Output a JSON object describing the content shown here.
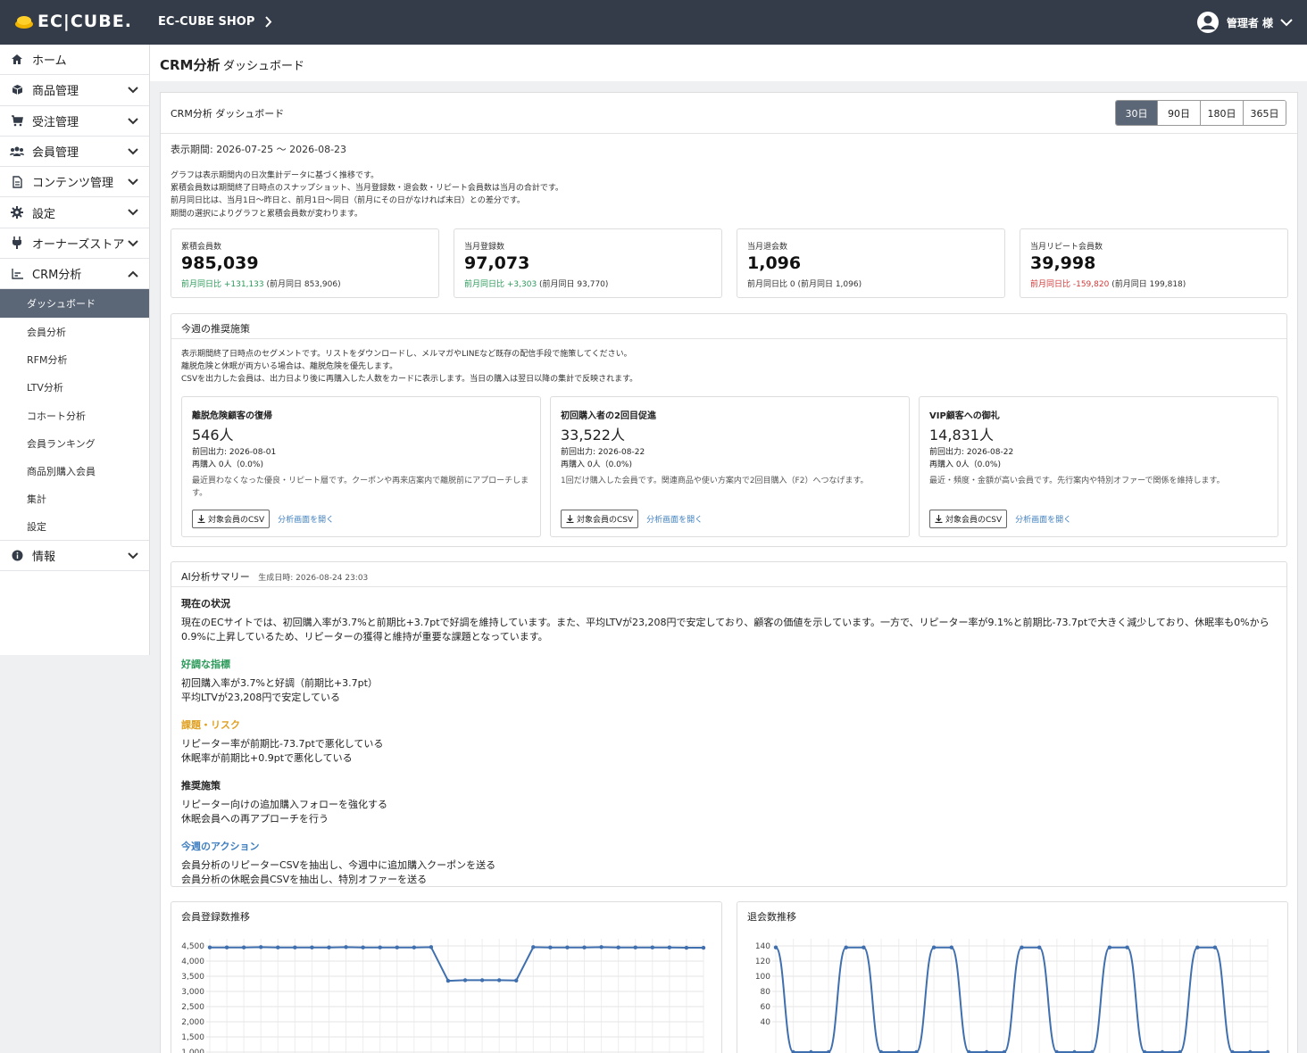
{
  "header": {
    "logo_text": "EC|CUBE.",
    "shop_name": "EC-CUBE SHOP",
    "user_label": "管理者 様"
  },
  "sidebar": {
    "items": [
      {
        "label": "ホーム",
        "icon": "home-icon"
      },
      {
        "label": "商品管理",
        "icon": "box-icon"
      },
      {
        "label": "受注管理",
        "icon": "cart-icon"
      },
      {
        "label": "会員管理",
        "icon": "users-icon"
      },
      {
        "label": "コンテンツ管理",
        "icon": "file-icon"
      },
      {
        "label": "設定",
        "icon": "gear-icon"
      },
      {
        "label": "オーナーズストア",
        "icon": "plug-icon"
      },
      {
        "label": "CRM分析",
        "icon": "chart-icon"
      }
    ],
    "crm_sub": [
      "ダッシュボード",
      "会員分析",
      "RFM分析",
      "LTV分析",
      "コホート分析",
      "会員ランキング",
      "商品別購入会員",
      "集計",
      "設定"
    ],
    "info": {
      "label": "情報",
      "icon": "info-icon"
    }
  },
  "page": {
    "title": "CRM分析",
    "subtitle": "ダッシュボード"
  },
  "panel": {
    "title": "CRM分析 ダッシュボード",
    "periods": [
      "30日",
      "90日",
      "180日",
      "365日"
    ],
    "selected_period": "30日",
    "range": "表示期間: 2026-07-25 〜 2026-08-23",
    "notes": [
      "グラフは表示期間内の日次集計データに基づく推移です。",
      "累積会員数は期間終了日時点のスナップショット、当月登録数・退会数・リピート会員数は当月の合計です。",
      "前月同日比は、当月1日〜昨日と、前月1日〜同日（前月にその日がなければ末日）との差分です。",
      "期間の選択によりグラフと累積会員数が変わります。"
    ]
  },
  "kpis": [
    {
      "label": "累積会員数",
      "value": "985,039",
      "delta": "前月同日比 +131,133",
      "prev": " (前月同日 853,906)",
      "trend": "up"
    },
    {
      "label": "当月登録数",
      "value": "97,073",
      "delta": "前月同日比 +3,303",
      "prev": " (前月同日 93,770)",
      "trend": "up"
    },
    {
      "label": "当月退会数",
      "value": "1,096",
      "delta": "前月同日比 0",
      "prev": " (前月同日 1,096)",
      "trend": "flat"
    },
    {
      "label": "当月リピート会員数",
      "value": "39,998",
      "delta": "前月同日比 -159,820",
      "prev": " (前月同日 199,818)",
      "trend": "down"
    }
  ],
  "recommend": {
    "title": "今週の推奨施策",
    "notes": [
      "表示期間終了日時点のセグメントです。リストをダウンロードし、メルマガやLINEなど既存の配信手段で施策してください。",
      "離脱危険と休眠が両方いる場合は、離脱危険を優先します。",
      "CSVを出力した会員は、出力日より後に再購入した人数をカードに表示します。当日の購入は翌日以降の集計で反映されます。"
    ],
    "csv_label": "対象会員のCSV",
    "link_label": "分析画面を開く",
    "cards": [
      {
        "title": "離脱危険顧客の復帰",
        "count": "546人",
        "exported": "前回出力: 2026-08-01",
        "rebuy": "再購入 0人（0.0%)",
        "desc": "最近買わなくなった優良・リピート層です。クーポンや再来店案内で離脱前にアプローチします。"
      },
      {
        "title": "初回購入者の2回目促進",
        "count": "33,522人",
        "exported": "前回出力: 2026-08-22",
        "rebuy": "再購入 0人（0.0%)",
        "desc": "1回だけ購入した会員です。関連商品や使い方案内で2回目購入（F2）へつなげます。"
      },
      {
        "title": "VIP顧客への御礼",
        "count": "14,831人",
        "exported": "前回出力: 2026-08-22",
        "rebuy": "再購入 0人（0.0%)",
        "desc": "最近・頻度・金額が高い会員です。先行案内や特別オファーで関係を維持します。"
      }
    ]
  },
  "ai": {
    "title": "AI分析サマリー",
    "generated": "生成日時: 2026-08-24 23:03",
    "status_h": "現在の状況",
    "status_p": "現在のECサイトでは、初回購入率が3.7%と前期比+3.7ptで好調を維持しています。また、平均LTVが23,208円で安定しており、顧客の価値を示しています。一方で、リピーター率が9.1%と前期比-73.7ptで大きく減少しており、休眠率も0%から0.9%に上昇しているため、リピーターの獲得と維持が重要な課題となっています。",
    "good_h": "好調な指標",
    "good": [
      "初回購入率が3.7%と好調（前期比+3.7pt）",
      "平均LTVが23,208円で安定している"
    ],
    "risk_h": "課題・リスク",
    "risk": [
      "リピーター率が前期比-73.7ptで悪化している",
      "休眠率が前期比+0.9ptで悪化している"
    ],
    "rec_h": "推奨施策",
    "rec": [
      "リピーター向けの追加購入フォローを強化する",
      "休眠会員への再アプローチを行う"
    ],
    "act_h": "今週のアクション",
    "act": [
      "会員分析のリピーターCSVを抽出し、今週中に追加購入クーポンを送る",
      "会員分析の休眠会員CSVを抽出し、特別オファーを送る"
    ]
  },
  "colors": {
    "header": "#333c48",
    "active": "#5b6676",
    "up": "#2b9a5a",
    "down": "#d23a3a",
    "line": "#3f6fae"
  },
  "chart_data": [
    {
      "type": "line",
      "title": "会員登録数推移",
      "yticks": [
        "4,500",
        "4,000",
        "3,500",
        "3,000",
        "2,500",
        "2,000",
        "1,500",
        "1,000"
      ],
      "ylim": [
        1000,
        4500
      ],
      "values": [
        4450,
        4450,
        4450,
        4460,
        4450,
        4450,
        4450,
        4450,
        4460,
        4450,
        4450,
        4450,
        4450,
        4460,
        3350,
        3370,
        3370,
        3370,
        3360,
        4460,
        4450,
        4450,
        4450,
        4460,
        4450,
        4450,
        4450,
        4450,
        4440,
        4440
      ]
    },
    {
      "type": "line",
      "title": "退会数推移",
      "yticks": [
        "140",
        "120",
        "100",
        "80",
        "60",
        "40"
      ],
      "ylim": [
        40,
        140
      ],
      "values": [
        138,
        0,
        0,
        0,
        138,
        138,
        0,
        0,
        0,
        138,
        138,
        0,
        0,
        0,
        138,
        138,
        0,
        0,
        0,
        138,
        138,
        0,
        0,
        0,
        138,
        138,
        0,
        0,
        0
      ]
    }
  ]
}
